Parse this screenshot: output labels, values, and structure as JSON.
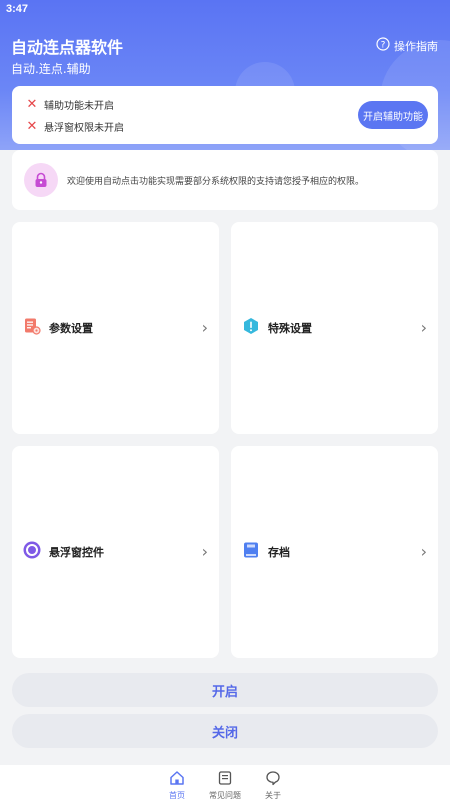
{
  "status_bar": {
    "time": "3:47"
  },
  "header": {
    "title": "自动连点器软件",
    "subtitle": "自动.连点.辅助",
    "guide_label": "操作指南"
  },
  "permissions": {
    "items": [
      {
        "label": "辅助功能未开启"
      },
      {
        "label": "悬浮窗权限未开启"
      }
    ],
    "enable_button": "开启辅助功能"
  },
  "welcome": {
    "text": "欢迎使用自动点击功能实现需要部分系统权限的支持请您授予相应的权限。"
  },
  "tiles": [
    {
      "label": "参数设置",
      "icon": "document-settings-icon"
    },
    {
      "label": "特殊设置",
      "icon": "alert-hexagon-icon"
    },
    {
      "label": "悬浮窗控件",
      "icon": "float-circle-icon"
    },
    {
      "label": "存档",
      "icon": "save-archive-icon"
    }
  ],
  "actions": {
    "start_label": "开启",
    "stop_label": "关闭"
  },
  "bottom_nav": {
    "items": [
      {
        "label": "首页",
        "icon": "home-icon",
        "active": true
      },
      {
        "label": "常见问题",
        "icon": "faq-icon",
        "active": false
      },
      {
        "label": "关于",
        "icon": "about-icon",
        "active": false
      }
    ]
  },
  "colors": {
    "accent": "#5b76f2",
    "header_gradient_start": "#5a74f3",
    "error": "#e6474a",
    "button_text": "#5468e8"
  }
}
